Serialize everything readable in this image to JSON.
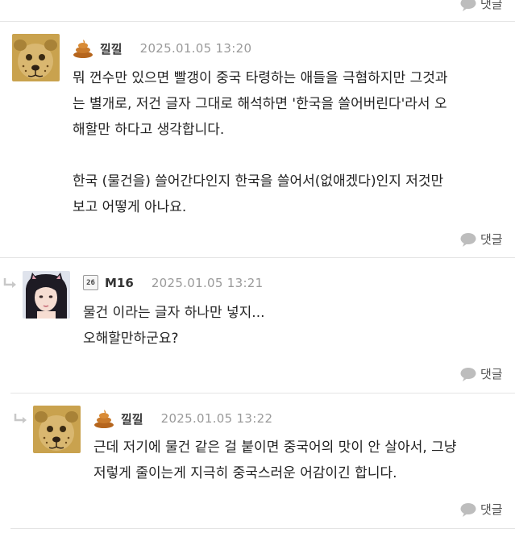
{
  "reply_label": "댓글",
  "comments": [
    {
      "nick": "낄낄",
      "date": "2025.01.05 13:20",
      "text": "뭐 껀수만 있으면 빨갱이 중국 타령하는 애들을 극혐하지만 그것과\n는 별개로, 저건 글자 그대로 해석하면 '한국을 쓸어버린다'라서 오\n해할만 하다고 생각합니다.\n\n한국 (물건을) 쓸어간다인지 한국을 쓸어서(없애겠다)인지 저것만\n보고 어떻게 아나요."
    },
    {
      "nick": "M16",
      "level": "26",
      "date": "2025.01.05 13:21",
      "text": "물건 이라는 글자 하나만 넣지...\n오해할만하군요?"
    },
    {
      "nick": "낄낄",
      "date": "2025.01.05 13:22",
      "text": "근데 저기에 물건 같은 걸 붙이면 중국어의 맛이 안 살아서, 그냥\n저렇게 줄이는게 지극히 중국스러운 어감이긴 합니다."
    }
  ]
}
